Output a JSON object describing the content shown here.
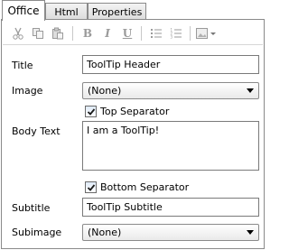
{
  "tabs": [
    {
      "label": "Office"
    },
    {
      "label": "Html"
    },
    {
      "label": "Properties"
    }
  ],
  "toolbar": {
    "items": [
      "cut-icon",
      "copy-icon",
      "paste-icon",
      "bold-button",
      "italic-button",
      "underline-button",
      "bullet-list-icon",
      "numbered-list-icon",
      "insert-image-icon"
    ],
    "bold": "B",
    "italic": "I",
    "underline": "U"
  },
  "form": {
    "title_label": "Title",
    "title_value": "ToolTip Header",
    "image_label": "Image",
    "image_value": "(None)",
    "top_separator_label": "Top Separator",
    "top_separator_checked": true,
    "body_label": "Body Text",
    "body_value": "I am a ToolTip!",
    "bottom_separator_label": "Bottom Separator",
    "bottom_separator_checked": true,
    "subtitle_label": "Subtitle",
    "subtitle_value": "ToolTip Subtitle",
    "subimage_label": "Subimage",
    "subimage_value": "(None)"
  },
  "colors": {
    "disabled_icon": "#9a9a9a",
    "border": "#7a7a7a"
  }
}
